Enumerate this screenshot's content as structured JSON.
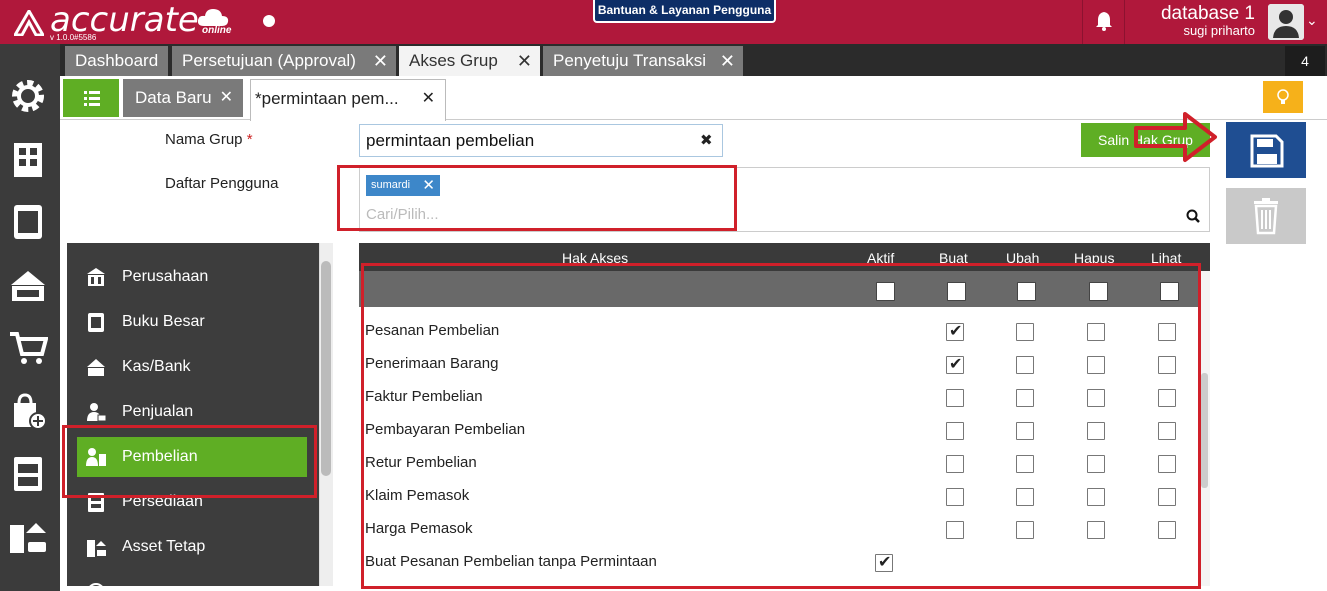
{
  "header": {
    "logo_text": "accurate",
    "logo_sub": "online",
    "version": "v 1.0.0#5586",
    "help_button": "Bantuan & Layanan Pengguna",
    "database": "database 1",
    "user": "sugi priharto"
  },
  "tabs_primary": [
    {
      "label": "Dashboard"
    },
    {
      "label": "Persetujuan (Approval)"
    },
    {
      "label": "Akses Grup"
    },
    {
      "label": "Penyetuju Transaksi"
    }
  ],
  "tabs_primary_count": "4",
  "tabs_secondary": [
    {
      "label": "Data Baru"
    },
    {
      "label": "*permintaan pem..."
    }
  ],
  "form": {
    "nama_grup_label": "Nama Grup",
    "required_mark": "*",
    "nama_grup_value": "permintaan pembelian",
    "daftar_pengguna_label": "Daftar Pengguna",
    "user_tag": "sumardi",
    "search_placeholder": "Cari/Pilih...",
    "copy_button": "Salin Hak Grup"
  },
  "modules": [
    {
      "label": "Perusahaan",
      "icon": "building-icon"
    },
    {
      "label": "Buku Besar",
      "icon": "book-icon"
    },
    {
      "label": "Kas/Bank",
      "icon": "cash-icon"
    },
    {
      "label": "Penjualan",
      "icon": "sales-icon"
    },
    {
      "label": "Pembelian",
      "icon": "purchase-icon"
    },
    {
      "label": "Persediaan",
      "icon": "inventory-icon"
    },
    {
      "label": "Asset Tetap",
      "icon": "asset-icon"
    }
  ],
  "table": {
    "headers": {
      "hak_akses": "Hak Akses",
      "aktif": "Aktif",
      "buat": "Buat",
      "ubah": "Ubah",
      "hapus": "Hapus",
      "lihat": "Lihat"
    },
    "rows": [
      {
        "label": "Pesanan Pembelian",
        "aktif": null,
        "buat": true,
        "ubah": false,
        "hapus": false,
        "lihat": false
      },
      {
        "label": "Penerimaan Barang",
        "aktif": null,
        "buat": true,
        "ubah": false,
        "hapus": false,
        "lihat": false
      },
      {
        "label": "Faktur Pembelian",
        "aktif": null,
        "buat": false,
        "ubah": false,
        "hapus": false,
        "lihat": false
      },
      {
        "label": "Pembayaran Pembelian",
        "aktif": null,
        "buat": false,
        "ubah": false,
        "hapus": false,
        "lihat": false
      },
      {
        "label": "Retur Pembelian",
        "aktif": null,
        "buat": false,
        "ubah": false,
        "hapus": false,
        "lihat": false
      },
      {
        "label": "Klaim Pemasok",
        "aktif": null,
        "buat": false,
        "ubah": false,
        "hapus": false,
        "lihat": false
      },
      {
        "label": "Harga Pemasok",
        "aktif": null,
        "buat": false,
        "ubah": false,
        "hapus": false,
        "lihat": false
      },
      {
        "label": "Buat Pesanan Pembelian tanpa Permintaan",
        "aktif": true,
        "buat": null,
        "ubah": null,
        "hapus": null,
        "lihat": null
      }
    ]
  },
  "colors": {
    "brand": "#b0183b",
    "accent_green": "#5fae24",
    "save_blue": "#1f4e92",
    "annotation_red": "#d0202a"
  }
}
